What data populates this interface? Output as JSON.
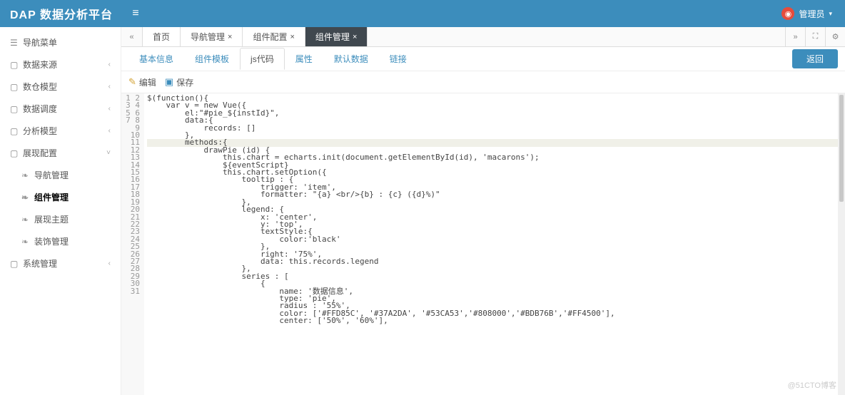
{
  "header": {
    "logo": "DAP 数据分析平台",
    "user_label": "管理员",
    "user_caret": "▾"
  },
  "sidebar": {
    "items": [
      {
        "icon": "☰",
        "label": "导航菜单",
        "chev": ""
      },
      {
        "icon": "▢",
        "label": "数据来源",
        "chev": "‹"
      },
      {
        "icon": "▢",
        "label": "数仓模型",
        "chev": "‹"
      },
      {
        "icon": "▢",
        "label": "数据调度",
        "chev": "‹"
      },
      {
        "icon": "▢",
        "label": "分析模型",
        "chev": "‹"
      },
      {
        "icon": "▢",
        "label": "展现配置",
        "chev": "˅",
        "expanded": true
      },
      {
        "icon": "▢",
        "label": "系统管理",
        "chev": "‹"
      }
    ],
    "subitems": [
      {
        "icon": "❧",
        "label": "导航管理"
      },
      {
        "icon": "❧",
        "label": "组件管理",
        "active": true
      },
      {
        "icon": "❧",
        "label": "展现主题"
      },
      {
        "icon": "❧",
        "label": "装饰管理"
      }
    ]
  },
  "tabs": {
    "nav_prev": "«",
    "nav_next": "»",
    "items": [
      {
        "label": "首页",
        "closable": false
      },
      {
        "label": "导航管理",
        "closable": true
      },
      {
        "label": "组件配置",
        "closable": true
      },
      {
        "label": "组件管理",
        "closable": true,
        "active": true
      }
    ],
    "tools": {
      "expand": "⛶",
      "settings": "⚙"
    }
  },
  "subtabs": {
    "items": [
      {
        "label": "基本信息"
      },
      {
        "label": "组件模板"
      },
      {
        "label": "js代码",
        "active": true
      },
      {
        "label": "属性"
      },
      {
        "label": "默认数据"
      },
      {
        "label": "链接"
      }
    ],
    "back_btn": "返回"
  },
  "toolbar": {
    "edit": "编辑",
    "save": "保存"
  },
  "editor": {
    "highlight_line": 7,
    "lines": [
      "$(function(){",
      "    var v = new Vue({",
      "        el:\"#pie_${instId}\",",
      "        data:{",
      "            records: []",
      "        },",
      "        methods:{",
      "            drawPie (id) {",
      "                this.chart = echarts.init(document.getElementById(id), 'macarons');",
      "                ${eventScript}",
      "                this.chart.setOption({",
      "                    tooltip : {",
      "                        trigger: 'item',",
      "                        formatter: \"{a} <br/>{b} : {c} ({d}%)\"",
      "                    },",
      "                    legend: {",
      "                        x: 'center',",
      "                        y: 'top',",
      "                        textStyle:{",
      "                            color:'black'",
      "                        },",
      "                        right: '75%',",
      "                        data: this.records.legend",
      "                    },",
      "                    series : [",
      "                        {",
      "                            name: '数据信息',",
      "                            type: 'pie',",
      "                            radius : '55%',",
      "                            color: ['#FFD85C', '#37A2DA', '#53CA53','#808000','#BDB76B','#FF4500'],",
      "                            center: ['50%', '60%'],"
    ]
  },
  "watermark": "@51CTO博客"
}
